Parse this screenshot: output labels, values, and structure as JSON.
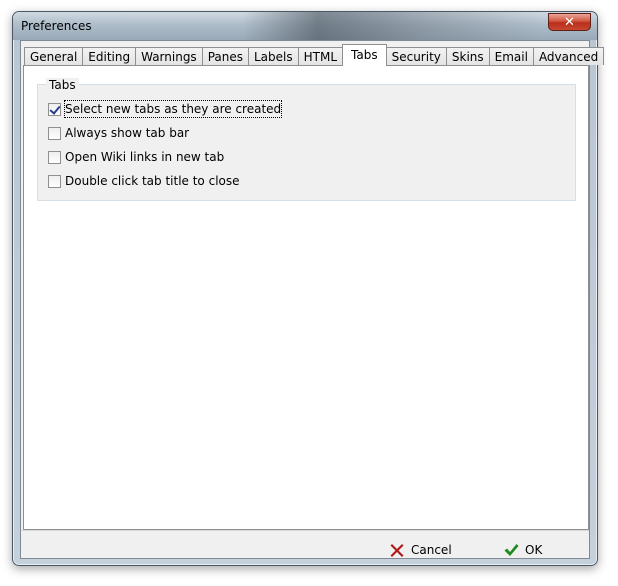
{
  "window": {
    "title": "Preferences",
    "close_label": "✕"
  },
  "tabs": [
    {
      "label": "General",
      "active": false
    },
    {
      "label": "Editing",
      "active": false
    },
    {
      "label": "Warnings",
      "active": false
    },
    {
      "label": "Panes",
      "active": false
    },
    {
      "label": "Labels",
      "active": false
    },
    {
      "label": "HTML",
      "active": false
    },
    {
      "label": "Tabs",
      "active": true
    },
    {
      "label": "Security",
      "active": false
    },
    {
      "label": "Skins",
      "active": false
    },
    {
      "label": "Email",
      "active": false
    },
    {
      "label": "Advanced",
      "active": false
    }
  ],
  "group": {
    "title": "Tabs",
    "options": [
      {
        "label": "Select new tabs as they are created",
        "checked": true
      },
      {
        "label": "Always show tab bar",
        "checked": false
      },
      {
        "label": "Open Wiki links in new tab",
        "checked": false
      },
      {
        "label": "Double click tab title to close",
        "checked": false
      }
    ]
  },
  "buttons": {
    "cancel_label": "Cancel",
    "ok_label": "OK"
  },
  "colors": {
    "cancel_icon": "#b01818",
    "ok_icon": "#1f8a1f"
  }
}
